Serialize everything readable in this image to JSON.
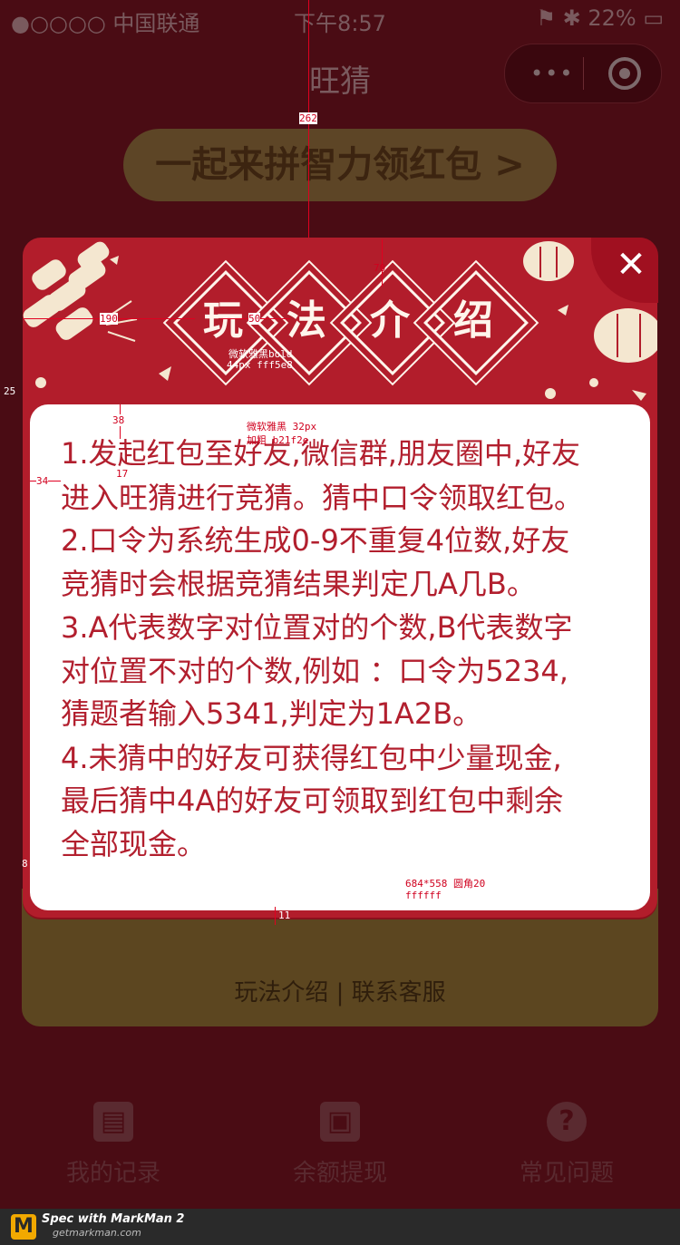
{
  "status_bar": {
    "carrier": "●○○○○ 中国联通",
    "time": "下午8:57",
    "battery": "22%"
  },
  "nav": {
    "title": "旺猜"
  },
  "banner": {
    "text": "一起来拼智力领红包 >"
  },
  "bottom_links": {
    "text": "玩法介绍 | 联系客服"
  },
  "tabs": [
    {
      "label": "我的记录",
      "icon": "record-book-icon"
    },
    {
      "label": "余额提现",
      "icon": "wallet-icon"
    },
    {
      "label": "常见问题",
      "icon": "question-icon"
    }
  ],
  "modal": {
    "title_chars": [
      "玩",
      "法",
      "介",
      "绍"
    ],
    "close": "✕",
    "rules": [
      "1.发起红包至好友,微信群,朋友圈中,好友",
      "进入旺猜进行竞猜。猜中口令领取红包。",
      "2.口令为系统生成0-9不重复4位数,好友",
      "竞猜时会根据竞猜结果判定几A几B。",
      "3.A代表数字对位置对的个数,B代表数字",
      "对位置不对的个数,例如 ：口令为5234,",
      "猜题者输入5341,判定为1A2B。",
      "4.未猜中的好友可获得红包中少量现金,",
      "最后猜中4A的好友可领取到红包中剩余",
      "全部现金。"
    ]
  },
  "annotations": {
    "a262": "262",
    "a70": "70",
    "a190": "190",
    "a50": "50",
    "title_font": "微软雅黑bold",
    "title_spec": "44px fff5e8",
    "a25": "25",
    "a38": "38",
    "body_font": "微软雅黑 32px",
    "body_spec": "加粗 b21f2e",
    "a34": "34",
    "a17": "17",
    "a8": "8",
    "box_spec": "684*558 圆角20",
    "box_color": "ffffff",
    "a11": "11"
  },
  "markman": {
    "brand": "Spec with MarkMan 2",
    "site": "getmarkman.com"
  },
  "colors": {
    "modal_red": "#b21d2b",
    "rule_text": "#b21f2e",
    "title_text": "#fff5e8"
  }
}
